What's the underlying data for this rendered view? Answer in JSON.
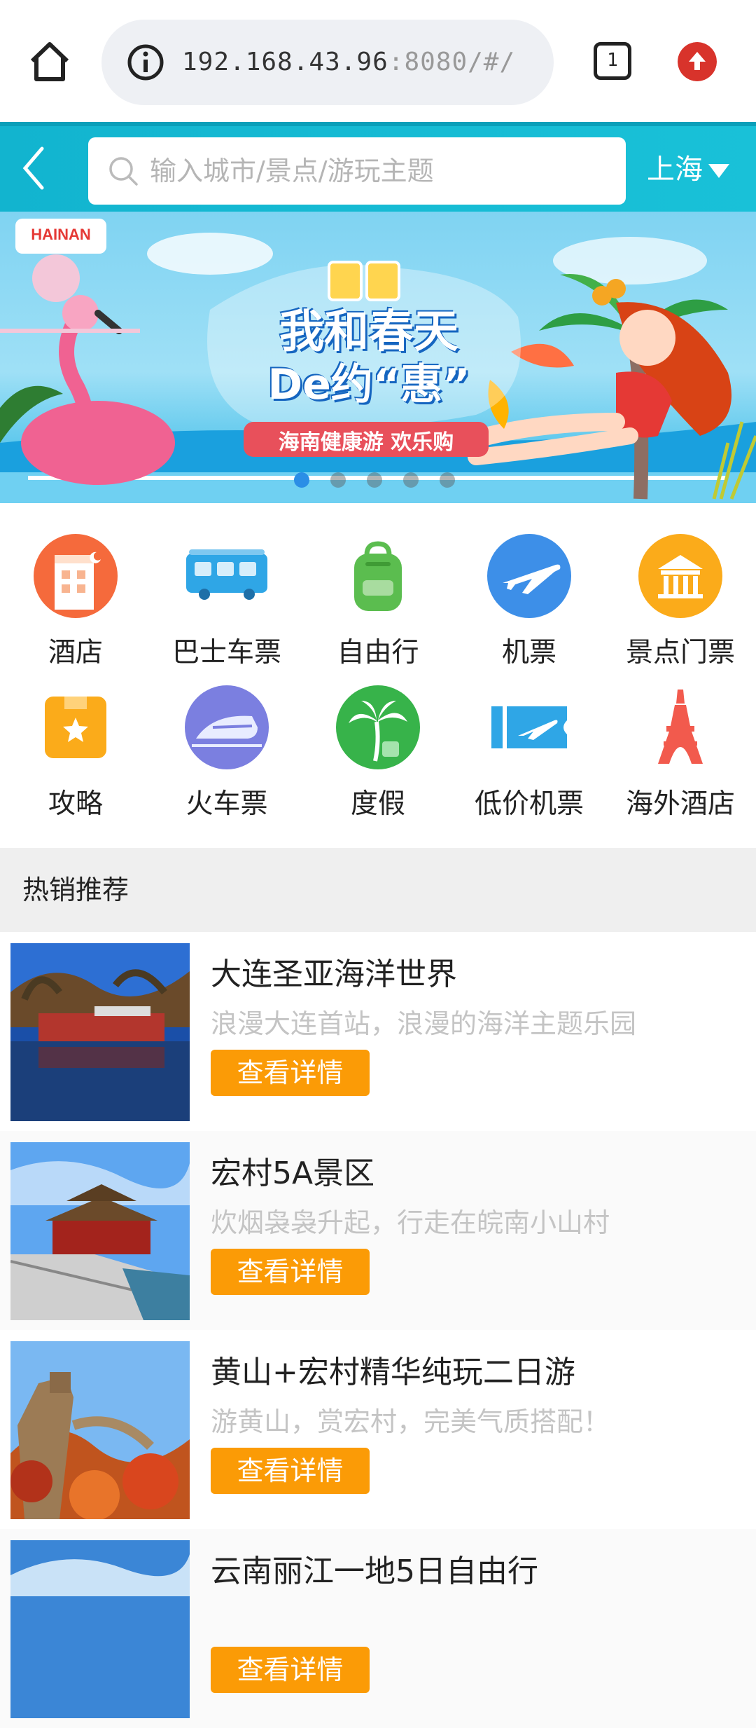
{
  "browser": {
    "url_host": "192.168.43.96",
    "url_rest": ":8080/#/",
    "tab_count": "1"
  },
  "header": {
    "search_placeholder": "输入城市/景点/游玩主题",
    "city": "上海"
  },
  "banner": {
    "badge": "HAINAN",
    "headline_line1": "我和春天",
    "headline_line2": "De约“惠”",
    "tagline": "海南健康游 欢乐购",
    "dot_count": 5,
    "active_dot": 0
  },
  "categories": [
    {
      "label": "酒店",
      "icon": "hotel-icon"
    },
    {
      "label": "巴士车票",
      "icon": "bus-icon"
    },
    {
      "label": "自由行",
      "icon": "backpack-icon"
    },
    {
      "label": "机票",
      "icon": "airplane-icon"
    },
    {
      "label": "景点门票",
      "icon": "scenic-icon"
    },
    {
      "label": "攻略",
      "icon": "guide-icon"
    },
    {
      "label": "火车票",
      "icon": "train-icon"
    },
    {
      "label": "度假",
      "icon": "palm-tree-icon"
    },
    {
      "label": "低价机票",
      "icon": "ticket-icon"
    },
    {
      "label": "海外酒店",
      "icon": "eiffel-tower-icon"
    }
  ],
  "section": {
    "title": "热销推荐"
  },
  "products": [
    {
      "name": "大连圣亚海洋世界",
      "desc": "浪漫大连首站，浪漫的海洋主题乐园",
      "button": "查看详情",
      "thumb": "palace-lake-photo"
    },
    {
      "name": "宏村5A景区",
      "desc": "炊烟袅袅升起，行走在皖南小山村",
      "button": "查看详情",
      "thumb": "forbidden-city-photo"
    },
    {
      "name": "黄山+宏村精华纯玩二日游",
      "desc": "游黄山，赏宏村，完美气质搭配！",
      "button": "查看详情",
      "thumb": "great-wall-photo"
    },
    {
      "name": "云南丽江一地5日自由行",
      "desc": "",
      "button": "查看详情",
      "thumb": "sky-photo"
    }
  ],
  "colors": {
    "header": "#19c1d8",
    "button": "#fb9b06",
    "section_bg": "#efefef"
  }
}
